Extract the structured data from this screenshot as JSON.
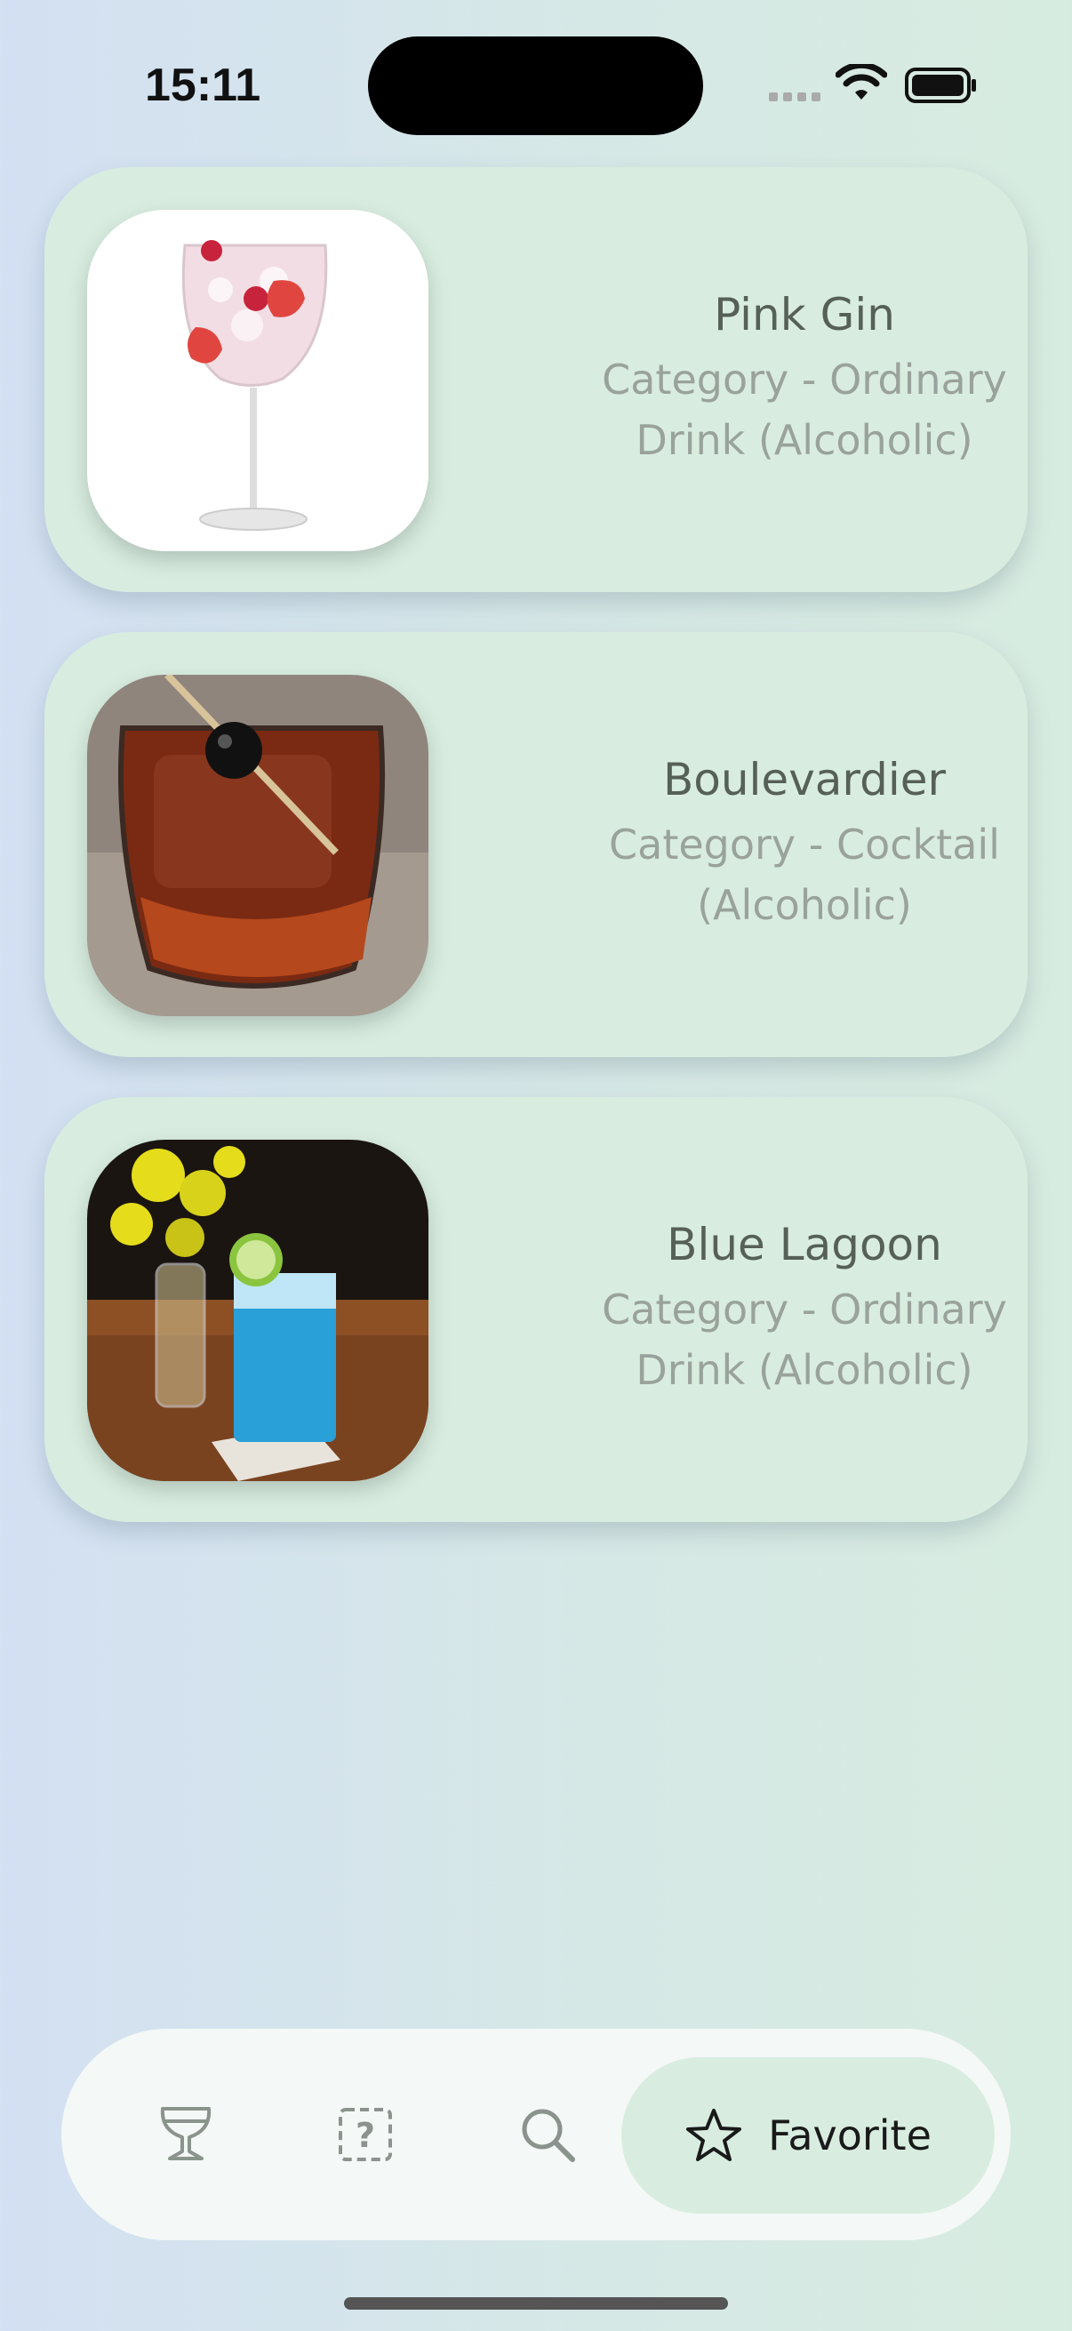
{
  "status_bar": {
    "time": "15:11"
  },
  "drinks": [
    {
      "name": "Pink Gin",
      "category": "Category - Ordinary Drink (Alcoholic)"
    },
    {
      "name": "Boulevardier",
      "category": "Category - Cocktail (Alcoholic)"
    },
    {
      "name": "Blue Lagoon",
      "category": "Category - Ordinary Drink (Alcoholic)"
    }
  ],
  "nav": {
    "items": [
      {
        "icon": "cocktail-glass-icon"
      },
      {
        "icon": "random-dice-icon"
      },
      {
        "icon": "search-icon"
      },
      {
        "icon": "star-icon",
        "label": "Favorite",
        "selected": true
      }
    ]
  },
  "colors": {
    "card": "#d8ede0",
    "selected_tab": "#d8ede0",
    "title_text": "#566057",
    "subtitle_text": "#9aa29c"
  }
}
